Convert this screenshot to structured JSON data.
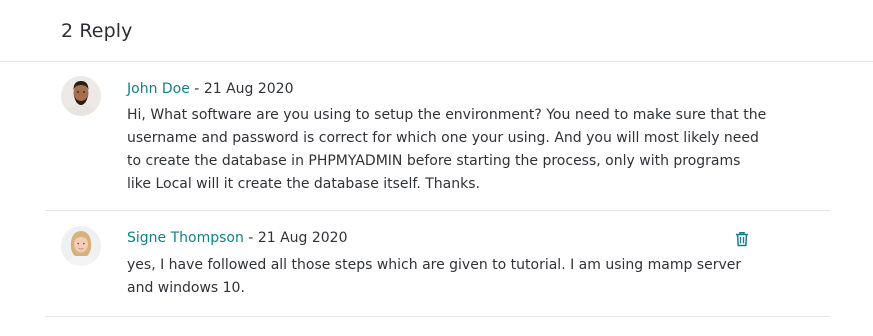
{
  "header": {
    "title": "2 Reply"
  },
  "replies": [
    {
      "author": "John Doe",
      "separator": " - ",
      "date": "21 Aug 2020",
      "text": "Hi, What software are you using to setup the environment? You need to make sure that the username and password is correct for which one your using. And you will most likely need to create the database in PHPMYADMIN before starting the process, only with programs like Local will it create the database itself. Thanks.",
      "avatar_icon": "avatar-male-beard"
    },
    {
      "author": "Signe Thompson",
      "separator": " - ",
      "date": "21 Aug 2020",
      "text": "yes, I have followed all those steps which are given to tutorial. I am using mamp server and windows 10.",
      "avatar_icon": "avatar-female-blonde",
      "action_icon": "trash-icon"
    }
  ],
  "colors": {
    "accent": "#11808a",
    "text": "#2f3237",
    "divider": "#e4e6ea"
  }
}
